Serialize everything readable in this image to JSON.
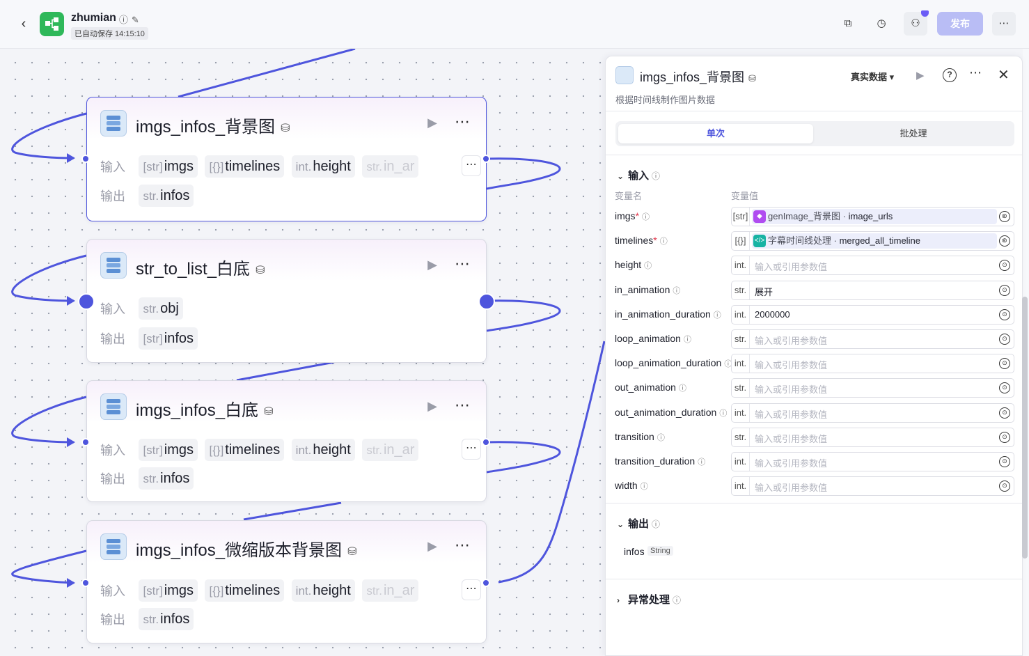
{
  "header": {
    "app_name": "zhumian",
    "autosave": "已自动保存 14:15:10",
    "publish_label": "发布"
  },
  "nodes": [
    {
      "title": "imgs_infos_背景图",
      "input_label": "输入",
      "output_label": "输出",
      "inputs": [
        {
          "type": "[str]",
          "name": "imgs"
        },
        {
          "type": "[{}]",
          "name": "timelines"
        },
        {
          "type": "int.",
          "name": "height"
        },
        {
          "type": "str.",
          "name": "in_ar"
        }
      ],
      "outputs": [
        {
          "type": "str.",
          "name": "infos"
        }
      ]
    },
    {
      "title": "str_to_list_白底",
      "input_label": "输入",
      "output_label": "输出",
      "inputs": [
        {
          "type": "str.",
          "name": "obj"
        }
      ],
      "outputs": [
        {
          "type": "[str]",
          "name": "infos"
        }
      ]
    },
    {
      "title": "imgs_infos_白底",
      "input_label": "输入",
      "output_label": "输出",
      "inputs": [
        {
          "type": "[str]",
          "name": "imgs"
        },
        {
          "type": "[{}]",
          "name": "timelines"
        },
        {
          "type": "int.",
          "name": "height"
        },
        {
          "type": "str.",
          "name": "in_ar"
        }
      ],
      "outputs": [
        {
          "type": "str.",
          "name": "infos"
        }
      ]
    },
    {
      "title": "imgs_infos_微缩版本背景图",
      "input_label": "输入",
      "output_label": "输出",
      "inputs": [
        {
          "type": "[str]",
          "name": "imgs"
        },
        {
          "type": "[{}]",
          "name": "timelines"
        },
        {
          "type": "int.",
          "name": "height"
        },
        {
          "type": "str.",
          "name": "in_ar"
        }
      ],
      "outputs": [
        {
          "type": "str.",
          "name": "infos"
        }
      ]
    }
  ],
  "panel": {
    "title": "imgs_infos_背景图",
    "description": "根据时间线制作图片数据",
    "real_data_label": "真实数据",
    "tabs": [
      "单次",
      "批处理"
    ],
    "input_section": "输入",
    "col_name": "变量名",
    "col_value": "变量值",
    "placeholder": "输入或引用参数值",
    "params": [
      {
        "name": "imgs",
        "required": true,
        "type": "[str]",
        "ref_node": "genImage_背景图",
        "ref_field": "image_urls",
        "ref_color": "#b04cf0"
      },
      {
        "name": "timelines",
        "required": true,
        "type": "[{}]",
        "ref_node": "字幕时间线处理",
        "ref_field": "merged_all_timeline",
        "ref_color": "#17b3a3"
      },
      {
        "name": "height",
        "type": "int.",
        "value": ""
      },
      {
        "name": "in_animation",
        "type": "str.",
        "value": "展开"
      },
      {
        "name": "in_animation_duration",
        "type": "int.",
        "value": "2000000"
      },
      {
        "name": "loop_animation",
        "type": "str.",
        "value": ""
      },
      {
        "name": "loop_animation_duration",
        "type": "int.",
        "value": ""
      },
      {
        "name": "out_animation",
        "type": "str.",
        "value": ""
      },
      {
        "name": "out_animation_duration",
        "type": "int.",
        "value": ""
      },
      {
        "name": "transition",
        "type": "str.",
        "value": ""
      },
      {
        "name": "transition_duration",
        "type": "int.",
        "value": ""
      },
      {
        "name": "width",
        "type": "int.",
        "value": ""
      }
    ],
    "output_section": "输出",
    "output_name": "infos",
    "output_type": "String",
    "error_section": "异常处理"
  },
  "colors": {
    "accent": "#4e55dd",
    "publish": "#b9bdf5"
  }
}
